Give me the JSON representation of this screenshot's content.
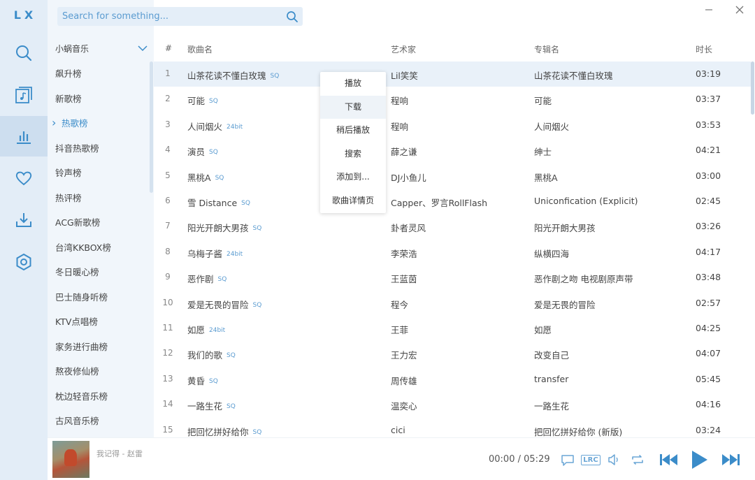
{
  "logo": "LX",
  "search": {
    "placeholder": "Search for something..."
  },
  "source": {
    "selected": "小蜗音乐"
  },
  "boards": [
    "飙升榜",
    "新歌榜",
    "热歌榜",
    "抖音热歌榜",
    "铃声榜",
    "热评榜",
    "ACG新歌榜",
    "台湾KKBOX榜",
    "冬日暖心榜",
    "巴士随身听榜",
    "KTV点唱榜",
    "家务进行曲榜",
    "熬夜修仙榜",
    "枕边轻音乐榜",
    "古风音乐榜"
  ],
  "active_board_index": 2,
  "table": {
    "headers": {
      "num": "#",
      "name": "歌曲名",
      "artist": "艺术家",
      "album": "专辑名",
      "time": "时长"
    },
    "rows": [
      {
        "num": "1",
        "name": "山茶花读不懂白玫瑰",
        "tag": "SQ",
        "artist": "Lil笑笑",
        "album": "山茶花读不懂白玫瑰",
        "time": "03:19"
      },
      {
        "num": "2",
        "name": "可能",
        "tag": "SQ",
        "artist": "程响",
        "album": "可能",
        "time": "03:37"
      },
      {
        "num": "3",
        "name": "人间烟火",
        "tag": "24bit",
        "artist": "程响",
        "album": "人间烟火",
        "time": "03:53"
      },
      {
        "num": "4",
        "name": "演员",
        "tag": "SQ",
        "artist": "薛之谦",
        "album": "绅士",
        "time": "04:21"
      },
      {
        "num": "5",
        "name": "黑桃A",
        "tag": "SQ",
        "artist": "DJ小鱼儿",
        "album": "黑桃A",
        "time": "03:00"
      },
      {
        "num": "6",
        "name": "雪 Distance",
        "tag": "SQ",
        "artist": "Capper、罗言RollFlash",
        "album": "Uniconfication (Explicit)",
        "time": "02:45"
      },
      {
        "num": "7",
        "name": "阳光开朗大男孩",
        "tag": "SQ",
        "artist": "卦者灵风",
        "album": "阳光开朗大男孩",
        "time": "03:26"
      },
      {
        "num": "8",
        "name": "乌梅子酱",
        "tag": "24bit",
        "artist": "李荣浩",
        "album": "纵横四海",
        "time": "04:17"
      },
      {
        "num": "9",
        "name": "恶作剧",
        "tag": "SQ",
        "artist": "王蓝茵",
        "album": "恶作剧之吻 电视剧原声带",
        "time": "03:48"
      },
      {
        "num": "10",
        "name": "爱是无畏的冒险",
        "tag": "SQ",
        "artist": "程今",
        "album": "爱是无畏的冒险",
        "time": "02:57"
      },
      {
        "num": "11",
        "name": "如愿",
        "tag": "24bit",
        "artist": "王菲",
        "album": "如愿",
        "time": "04:25"
      },
      {
        "num": "12",
        "name": "我们的歌",
        "tag": "SQ",
        "artist": "王力宏",
        "album": "改变自己",
        "time": "04:07"
      },
      {
        "num": "13",
        "name": "黄昏",
        "tag": "SQ",
        "artist": "周传雄",
        "album": "transfer",
        "time": "05:45"
      },
      {
        "num": "14",
        "name": "一路生花",
        "tag": "SQ",
        "artist": "温奕心",
        "album": "一路生花",
        "time": "04:16"
      },
      {
        "num": "15",
        "name": "把回忆拼好给你",
        "tag": "SQ",
        "artist": "cici",
        "album": "把回忆拼好给你 (新版)",
        "time": "03:24"
      }
    ]
  },
  "context_menu": [
    "播放",
    "下载",
    "稍后播放",
    "搜索",
    "添加到...",
    "歌曲详情页"
  ],
  "context_menu_hover_index": 1,
  "player": {
    "now_playing": "我记得 - 赵雷",
    "current_time": "00:00",
    "separator": "/",
    "total_time": "05:29",
    "lyric_label": "LRC"
  },
  "icons": {
    "rail": [
      "search-icon",
      "music-library-icon",
      "chart-icon",
      "heart-icon",
      "download-icon",
      "settings-icon"
    ],
    "player": [
      "comment-icon",
      "lyric-icon",
      "volume-icon",
      "repeat-icon",
      "previous-icon",
      "play-icon",
      "next-icon"
    ]
  },
  "colors": {
    "accent": "#3b8cc9",
    "rail_bg": "#e3edf7",
    "sidebar_bg": "#f1f6fb",
    "selected_row": "#e9f1f9"
  }
}
